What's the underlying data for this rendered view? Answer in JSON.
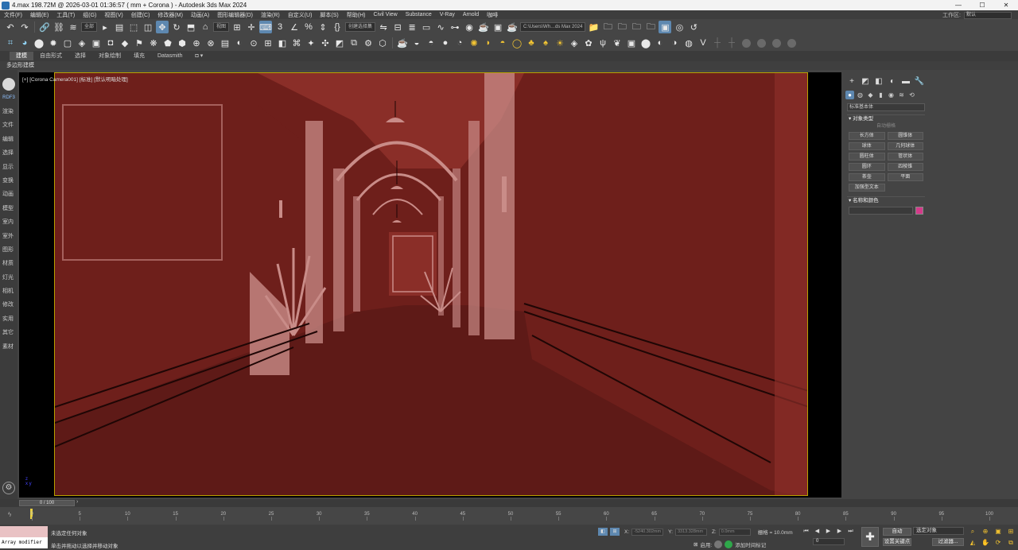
{
  "window": {
    "title": "4.max   198.72M @ 2026-03-01 01:36:57  ( mm + Corona ) - Autodesk 3ds Max 2024",
    "minimize": "—",
    "maximize": "☐",
    "close": "✕"
  },
  "menus": [
    "文件(F)",
    "编辑(E)",
    "工具(T)",
    "组(G)",
    "视图(V)",
    "创建(C)",
    "修改器(M)",
    "动画(A)",
    "图形编辑器(D)",
    "渲染(R)",
    "自定义(U)",
    "脚本(S)",
    "帮助(H)",
    "Civil View",
    "Substance",
    "V-Ray",
    "Arnold",
    "咖啡"
  ],
  "workspace": {
    "label": "工作区:",
    "value": "默认"
  },
  "toolbar1": {
    "filter_value": "全部",
    "refcoord_value": "视图",
    "selset_value": "创建选择集",
    "path_value": "C:\\Users\\Wh…ds Max 2024"
  },
  "ribbon": {
    "tabs": [
      "建模",
      "自由形式",
      "选择",
      "对象绘制",
      "填充",
      "Datasmith"
    ],
    "active": "建模",
    "sub_label": "多边形建模"
  },
  "left_strip": {
    "rdf": "RDF3",
    "items": [
      "渲染",
      "文件",
      "编辑",
      "选择",
      "显示",
      "变换",
      "动画",
      "模型",
      "室内",
      "室外",
      "图形",
      "材质",
      "灯光",
      "相机",
      "修改",
      "实用",
      "其它",
      "素材"
    ]
  },
  "viewport": {
    "label": "[+] [Corona Camera001] [标准] [默认明暗处理]",
    "colors": {
      "wall": "#6e1f1b",
      "wall_light": "#8a2e28",
      "floor": "#5e1a17",
      "trim": "#c98c88",
      "line": "#1e0605",
      "glow": "#e6c8c8"
    }
  },
  "command_panel": {
    "tabs": [
      "+",
      "◩",
      "◧",
      "◐",
      "▬",
      "🔧"
    ],
    "categories": [
      "●",
      "◍",
      "◆",
      "▮",
      "◉",
      "≋",
      "⟲"
    ],
    "dropdown": "标准基本体",
    "object_type_header": "对象类型",
    "autogrid": "自动栅格",
    "objects": [
      "长方体",
      "圆锥体",
      "球体",
      "几何球体",
      "圆柱体",
      "管状体",
      "圆环",
      "四棱锥",
      "茶壶",
      "平面",
      "加强型文本"
    ],
    "name_color_header": "名称和颜色",
    "swatch_color": "#d43a8a"
  },
  "timeline": {
    "frame_display": "0 / 100",
    "ticks": [
      "0",
      "5",
      "10",
      "15",
      "20",
      "25",
      "30",
      "35",
      "40",
      "45",
      "50",
      "55",
      "60",
      "65",
      "70",
      "75",
      "80",
      "85",
      "90",
      "95",
      "100"
    ]
  },
  "status": {
    "maxscript": "Array modifier",
    "line1": "未选定任何对象",
    "line2": "单击并拖动以选择并移动对象",
    "x_label": "X:",
    "x_value": "-5240.302mm",
    "y_label": "Y:",
    "y_value": "3313.328mm",
    "z_label": "Z:",
    "z_value": "0.0mm",
    "grid": "栅格 = 10.0mm",
    "enable_label": "启用:",
    "add_time_tag": "添加时间标记",
    "frame_value": "0",
    "autokey": "自动",
    "setkey": "设置关键点",
    "selset": "选定对象",
    "filters": "过滤器..."
  }
}
